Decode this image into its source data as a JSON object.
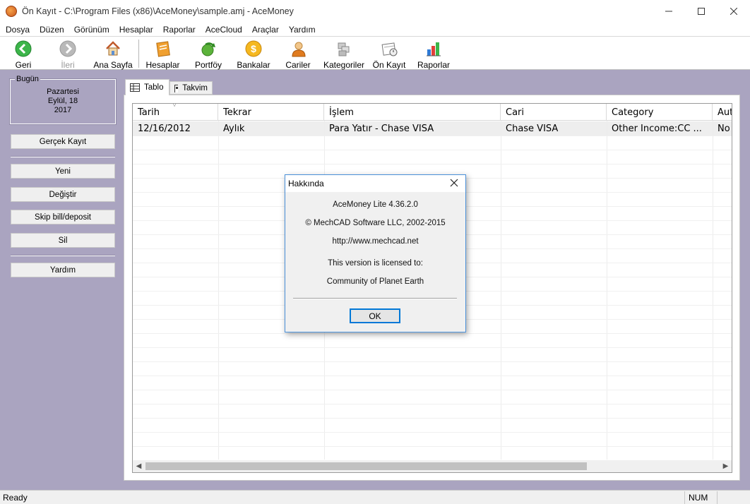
{
  "window": {
    "title": "Ön Kayıt - C:\\Program Files (x86)\\AceMoney\\sample.amj - AceMoney",
    "minimize": "—",
    "maximize": "☐",
    "close": "✕"
  },
  "menu": [
    "Dosya",
    "Düzen",
    "Görünüm",
    "Hesaplar",
    "Raporlar",
    "AceCloud",
    "Araçlar",
    "Yardım"
  ],
  "toolbar": {
    "back": "Geri",
    "forward": "İleri",
    "home": "Ana Sayfa",
    "accounts": "Hesaplar",
    "portfolio": "Portföy",
    "banks": "Bankalar",
    "payees": "Cariler",
    "categories": "Kategoriler",
    "scheduled": "Ön Kayıt",
    "reports": "Raporlar"
  },
  "today": {
    "legend": "Bugün",
    "weekday": "Pazartesi",
    "date": "Eylül, 18",
    "year": "2017"
  },
  "side_buttons": {
    "enter_now": "Gerçek Kayıt",
    "new": "Yeni",
    "edit": "Değiştir",
    "skip": "Skip bill/deposit",
    "delete": "Sil",
    "help": "Yardım"
  },
  "tabs": {
    "table": "Tablo",
    "calendar": "Takvim"
  },
  "grid": {
    "columns": [
      "Tarih",
      "Tekrar",
      "İşlem",
      "Cari",
      "Category",
      "Aut"
    ],
    "rows": [
      [
        "12/16/2012",
        "Aylık",
        "Para Yatır - Chase VISA",
        "Chase VISA",
        "Other Income:CC ...",
        "No"
      ]
    ]
  },
  "dialog": {
    "title": "Hakkında",
    "product": "AceMoney Lite 4.36.2.0",
    "copyright": "© MechCAD Software LLC, 2002-2015",
    "url": "http://www.mechcad.net",
    "licensed_label": "This version is licensed to:",
    "licensee": "Community of Planet Earth",
    "ok": "OK"
  },
  "status": {
    "text": "Ready",
    "num": "NUM"
  }
}
